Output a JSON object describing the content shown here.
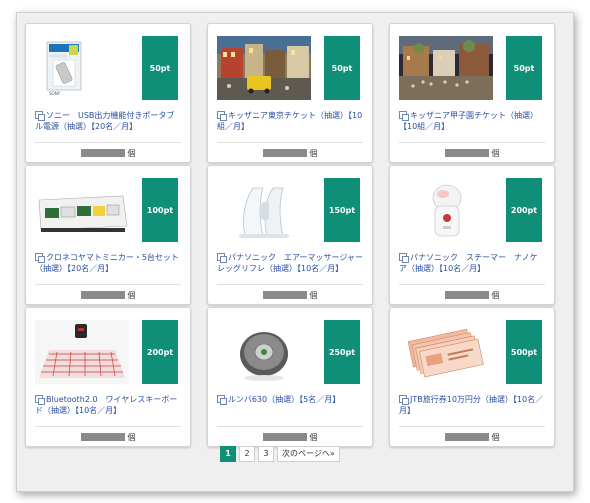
{
  "items": [
    {
      "title": "ソニー　USB出力機能付きポータブル電源（抽選）【20名／月】",
      "points": "50pt",
      "price_unit": "個",
      "image": "portable-battery-image"
    },
    {
      "title": "キッザニア東京チケット（抽選）【10組／月】",
      "points": "50pt",
      "price_unit": "個",
      "image": "kidzania-tokyo-photo"
    },
    {
      "title": "キッザニア甲子園チケット（抽選）【10組／月】",
      "points": "50pt",
      "price_unit": "個",
      "image": "kidzania-koshien-photo"
    },
    {
      "title": "クロネコヤマトミニカー・5台セット（抽選）【20名／月】",
      "points": "100pt",
      "price_unit": "個",
      "image": "minicar-set-image"
    },
    {
      "title": "パナソニック　エアーマッサージャー　レッグリフレ（抽選）【10名／月】",
      "points": "150pt",
      "price_unit": "個",
      "image": "leg-massager-image"
    },
    {
      "title": "パナソニック　スチーマー　ナノケア（抽選）【10名／月】",
      "points": "200pt",
      "price_unit": "個",
      "image": "facial-steamer-image"
    },
    {
      "title": "Bluetooth2.0　ワイヤレスキーボード（抽選）【10名／月】",
      "points": "200pt",
      "price_unit": "個",
      "image": "laser-keyboard-image"
    },
    {
      "title": "ルンバ630（抽選）【5名／月】",
      "points": "250pt",
      "price_unit": "個",
      "image": "robot-vacuum-image"
    },
    {
      "title": "JTB旅行券10万円分（抽選）【10名／月】",
      "points": "500pt",
      "price_unit": "個",
      "image": "travel-voucher-image"
    }
  ],
  "pagination": {
    "pages": [
      "1",
      "2",
      "3"
    ],
    "current": "1",
    "next_label": "次のページへ»"
  },
  "colors": {
    "badge": "#0f8f78",
    "link": "#2a4ea0"
  }
}
